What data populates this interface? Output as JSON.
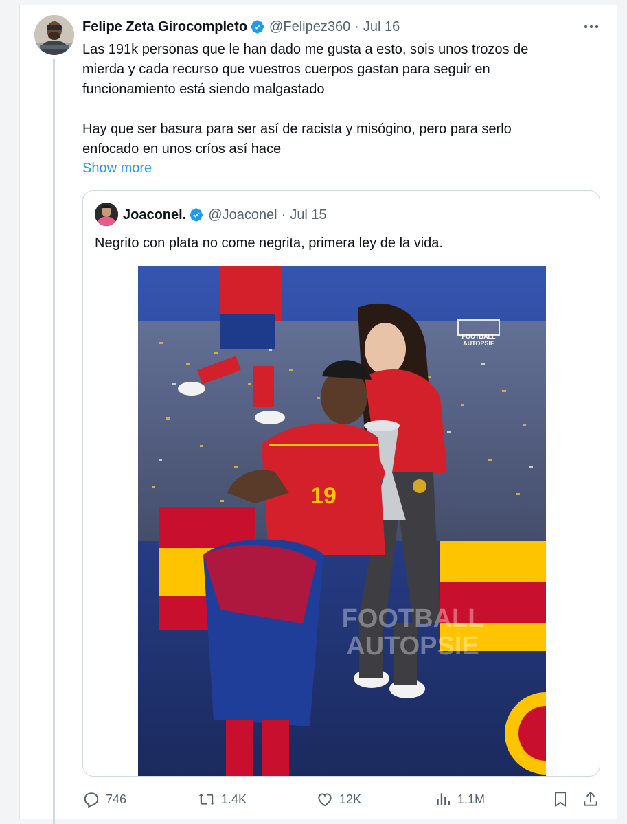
{
  "tweet": {
    "author_name": "Felipe Zeta Girocompleto",
    "handle": "@Felipez360",
    "separator": "·",
    "date": "Jul 16",
    "text_line1": "Las 191k personas que le han dado me gusta a esto, sois unos trozos de",
    "text_line2": "mierda y cada recurso que vuestros cuerpos gastan para seguir en",
    "text_line3": "funcionamiento está siendo malgastado",
    "text_line4": "Hay que ser basura para ser así de racista y misógino, pero para serlo",
    "text_line5": "enfocado en unos críos así hace",
    "show_more": "Show more"
  },
  "quoted_tweet": {
    "author_name": "Joaconel.",
    "handle": "@Joaconel",
    "separator": "·",
    "date": "Jul 15",
    "text": "Negrito con plata no come negrita, primera ley de la vida.",
    "image": {
      "watermark_top_line1": "FOOTBALL",
      "watermark_top_line2": "AUTOPSIE",
      "watermark_center_line1": "FOOTBALL",
      "watermark_center_line2": "AUTOPSIE",
      "jersey_number": "19"
    }
  },
  "actions": {
    "replies": "746",
    "reposts": "1.4K",
    "likes": "12K",
    "views": "1.1M"
  },
  "colors": {
    "accent": "#1d9bf0",
    "muted": "#536471",
    "text": "#0f1419",
    "border": "#cfd9de"
  },
  "icons": [
    "verified-badge-icon",
    "more-options-icon",
    "reply-icon",
    "repost-icon",
    "like-icon",
    "views-icon",
    "bookmark-icon",
    "share-icon"
  ]
}
